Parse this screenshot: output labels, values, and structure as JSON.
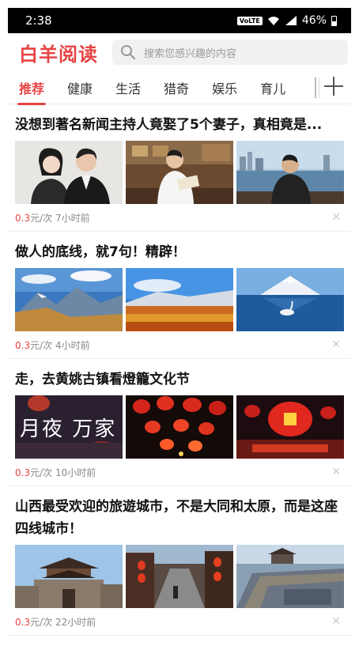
{
  "statusbar": {
    "time": "2:38",
    "network": "VoLTE",
    "battery": "46%"
  },
  "header": {
    "logo": "白羊阅读",
    "search_placeholder": "搜索您感兴趣的内容"
  },
  "tabs": [
    {
      "label": "推荐",
      "active": true
    },
    {
      "label": "健康",
      "active": false
    },
    {
      "label": "生活",
      "active": false
    },
    {
      "label": "猎奇",
      "active": false
    },
    {
      "label": "娱乐",
      "active": false
    },
    {
      "label": "育儿",
      "active": false
    }
  ],
  "articles": [
    {
      "title": "没想到著名新闻主持人竟娶了5个妻子，真相竟是...",
      "price": "0.3",
      "unit": "元/次",
      "time": "7小时前",
      "images": [
        "couple-portrait",
        "man-reading-in-tea-room",
        "man-by-waterfront-city"
      ]
    },
    {
      "title": "做人的底线，就7句！精辟！",
      "price": "0.3",
      "unit": "元/次",
      "time": "4小时前",
      "images": [
        "mountain-lake-landscape",
        "autumn-field-mountains",
        "snow-mountain-swan-lake"
      ]
    },
    {
      "title": "走，去黄姚古镇看燈籠文化节",
      "price": "0.3",
      "unit": "元/次",
      "time": "10小时前",
      "overlay_text": "月夜 万家",
      "images": [
        "night-lanterns-text",
        "red-lanterns-street",
        "lantern-festival-stage"
      ]
    },
    {
      "title": "山西最受欢迎的旅遊城市，不是大同和太原，而是这座四线城市！",
      "price": "0.3",
      "unit": "元/次",
      "time": "22小时前",
      "images": [
        "ancient-city-gate-tower",
        "old-town-street-lanterns",
        "city-wall-aerial"
      ]
    }
  ]
}
